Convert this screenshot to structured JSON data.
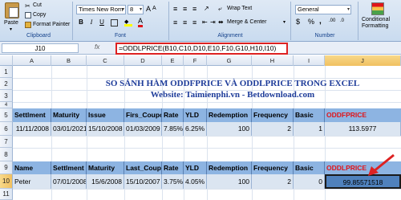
{
  "ribbon": {
    "clipboard": {
      "paste": "Paste",
      "cut": "Cut",
      "copy": "Copy",
      "format_painter": "Format Painter",
      "group": "Clipboard"
    },
    "font": {
      "name": "Times New Rom",
      "size": "8",
      "group": "Font",
      "bold": "B",
      "italic": "I",
      "underline": "U"
    },
    "alignment": {
      "wrap_text": "Wrap Text",
      "merge_center": "Merge & Center",
      "group": "Alignment"
    },
    "number": {
      "format": "General",
      "percent": "%",
      "comma": ",",
      "group": "Number"
    },
    "styles": {
      "conditional": "Conditional",
      "formatting": "Formatting"
    }
  },
  "formula_bar": {
    "name_box": "J10",
    "fx": "fx",
    "formula": "=ODDLPRICE(B10,C10,D10,E10,F10,G10,H10,I10)"
  },
  "columns": [
    "A",
    "B",
    "C",
    "D",
    "E",
    "F",
    "G",
    "H",
    "I",
    "J"
  ],
  "rows": [
    "1",
    "2",
    "3",
    "4",
    "5",
    "6",
    "7",
    "8",
    "9",
    "10",
    "11"
  ],
  "sheet": {
    "title": "SO SÁNH HÀM ODDFPRICE VÀ ODDLPRICE TRONG EXCEL",
    "website": "Website: Taimienphi.vn - Betdownload.com",
    "table1_headers": [
      "Settlment",
      "Maturity",
      "Issue",
      "Firs_Coupon",
      "Rate",
      "YLD",
      "Redemption",
      "Frequency",
      "Basic",
      "ODDFPRICE"
    ],
    "table1_row": [
      "11/11/2008",
      "03/01/2021",
      "15/10/2008",
      "01/03/2009",
      "7.85%",
      "6.25%",
      "100",
      "2",
      "1",
      "113.5977"
    ],
    "table2_headers": [
      "Name",
      "Settlment",
      "Maturity",
      "Last_Coupon",
      "Rate",
      "YLD",
      "Redemption",
      "Frequency",
      "Basic",
      "ODDLPRICE"
    ],
    "table2_row": [
      "Peter",
      "07/01/2008",
      "15/6/2008",
      "15/10/2007",
      "3.75%",
      "4.05%",
      "100",
      "2",
      "0",
      "99.85571518"
    ]
  },
  "colors": {
    "header_fill": "#8db4e2",
    "data_fill": "#dbe5f1",
    "title": "#1f3d9a",
    "red": "#e0151a",
    "arrow": "#d22"
  }
}
